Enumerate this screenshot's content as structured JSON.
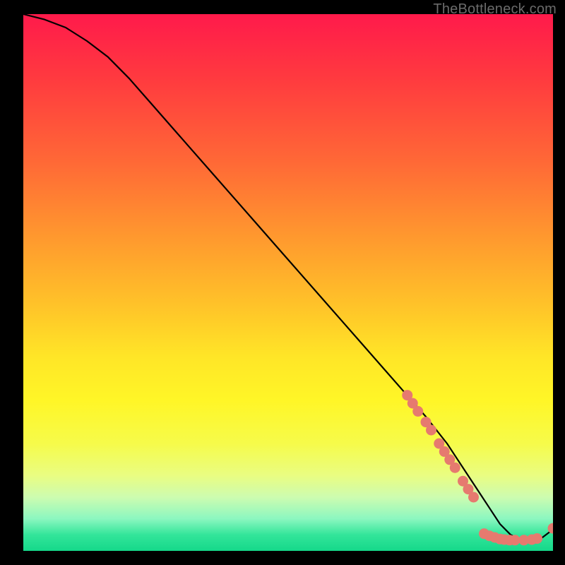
{
  "watermark": "TheBottleneck.com",
  "colors": {
    "curve_stroke": "#000000",
    "marker_fill": "#e67a6f",
    "marker_stroke": "#cf5f52",
    "background": "#000000"
  },
  "chart_data": {
    "type": "line",
    "title": "",
    "xlabel": "",
    "ylabel": "",
    "xlim": [
      0,
      100
    ],
    "ylim": [
      0,
      100
    ],
    "grid": false,
    "legend": false,
    "series": [
      {
        "name": "bottleneck-curve",
        "x": [
          0,
          4,
          8,
          12,
          16,
          20,
          24,
          28,
          32,
          36,
          40,
          44,
          48,
          52,
          56,
          60,
          64,
          68,
          72,
          76,
          80,
          82,
          84,
          86,
          88,
          90,
          92,
          94,
          96,
          98,
          100
        ],
        "y": [
          100,
          99,
          97.5,
          95,
          92,
          88,
          83.5,
          79,
          74.5,
          70,
          65.5,
          61,
          56.5,
          52,
          47.5,
          43,
          38.5,
          34,
          29.5,
          25,
          20,
          17,
          14,
          11,
          8,
          5,
          3,
          2,
          2,
          2.5,
          4
        ]
      }
    ],
    "markers": [
      {
        "x": 72.5,
        "y": 29
      },
      {
        "x": 73.5,
        "y": 27.5
      },
      {
        "x": 74.5,
        "y": 26
      },
      {
        "x": 76,
        "y": 24
      },
      {
        "x": 77,
        "y": 22.5
      },
      {
        "x": 78.5,
        "y": 20
      },
      {
        "x": 79.5,
        "y": 18.5
      },
      {
        "x": 80.5,
        "y": 17
      },
      {
        "x": 81.5,
        "y": 15.5
      },
      {
        "x": 83,
        "y": 13
      },
      {
        "x": 84,
        "y": 11.5
      },
      {
        "x": 85,
        "y": 10
      },
      {
        "x": 87,
        "y": 3.2
      },
      {
        "x": 88,
        "y": 2.8
      },
      {
        "x": 89,
        "y": 2.5
      },
      {
        "x": 90,
        "y": 2.2
      },
      {
        "x": 90.8,
        "y": 2.1
      },
      {
        "x": 91.8,
        "y": 2.0
      },
      {
        "x": 92.8,
        "y": 2.0
      },
      {
        "x": 94.5,
        "y": 2.0
      },
      {
        "x": 96,
        "y": 2.1
      },
      {
        "x": 97,
        "y": 2.3
      },
      {
        "x": 100,
        "y": 4.2
      }
    ]
  }
}
